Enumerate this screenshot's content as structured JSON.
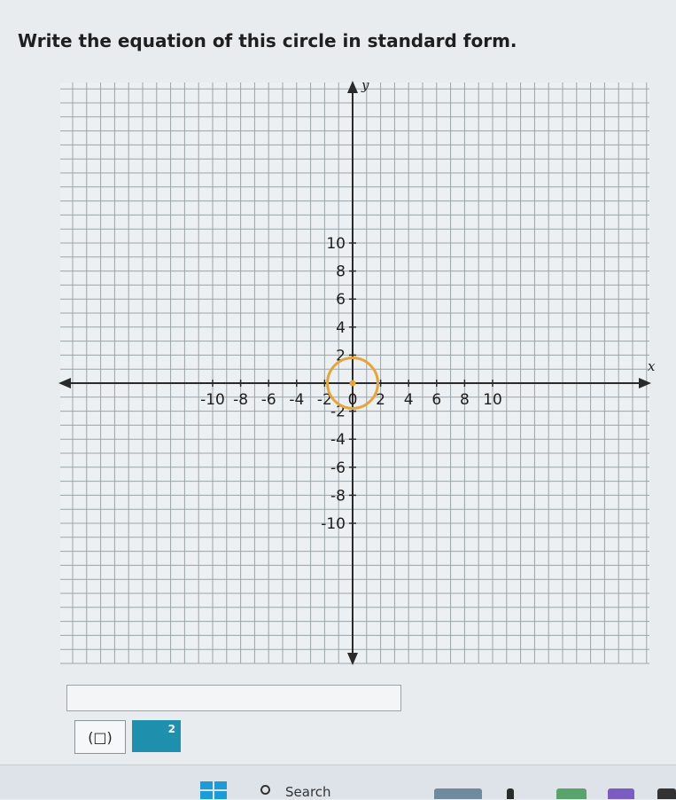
{
  "question": "Write the equation of this circle in standard form.",
  "chart_data": {
    "type": "scatter",
    "title": "",
    "xlabel": "x",
    "ylabel": "y",
    "xlim": [
      -10,
      10
    ],
    "ylim": [
      -10,
      10
    ],
    "grid": true,
    "x_ticks": [
      "-10",
      "-8",
      "-6",
      "-4",
      "-2",
      "0",
      "2",
      "4",
      "6",
      "8",
      "10"
    ],
    "y_ticks": [
      "10",
      "8",
      "6",
      "4",
      "2",
      "-2",
      "-4",
      "-6",
      "-8",
      "-10"
    ],
    "circle": {
      "center": [
        0,
        0
      ],
      "radius": 1,
      "color": "#e6a43c"
    },
    "center_point": {
      "x": 0,
      "y": 0
    }
  },
  "answer": {
    "value": ""
  },
  "buttons": {
    "paren_label": "(□)",
    "square_label": "2"
  },
  "taskbar": {
    "search_label": "Search"
  },
  "colors": {
    "grid": "#9aa4a8",
    "axis": "#2a2a2a",
    "circle": "#e6a43c",
    "accent_button": "#1f8fae",
    "start_icon": "#1d9bd6"
  }
}
